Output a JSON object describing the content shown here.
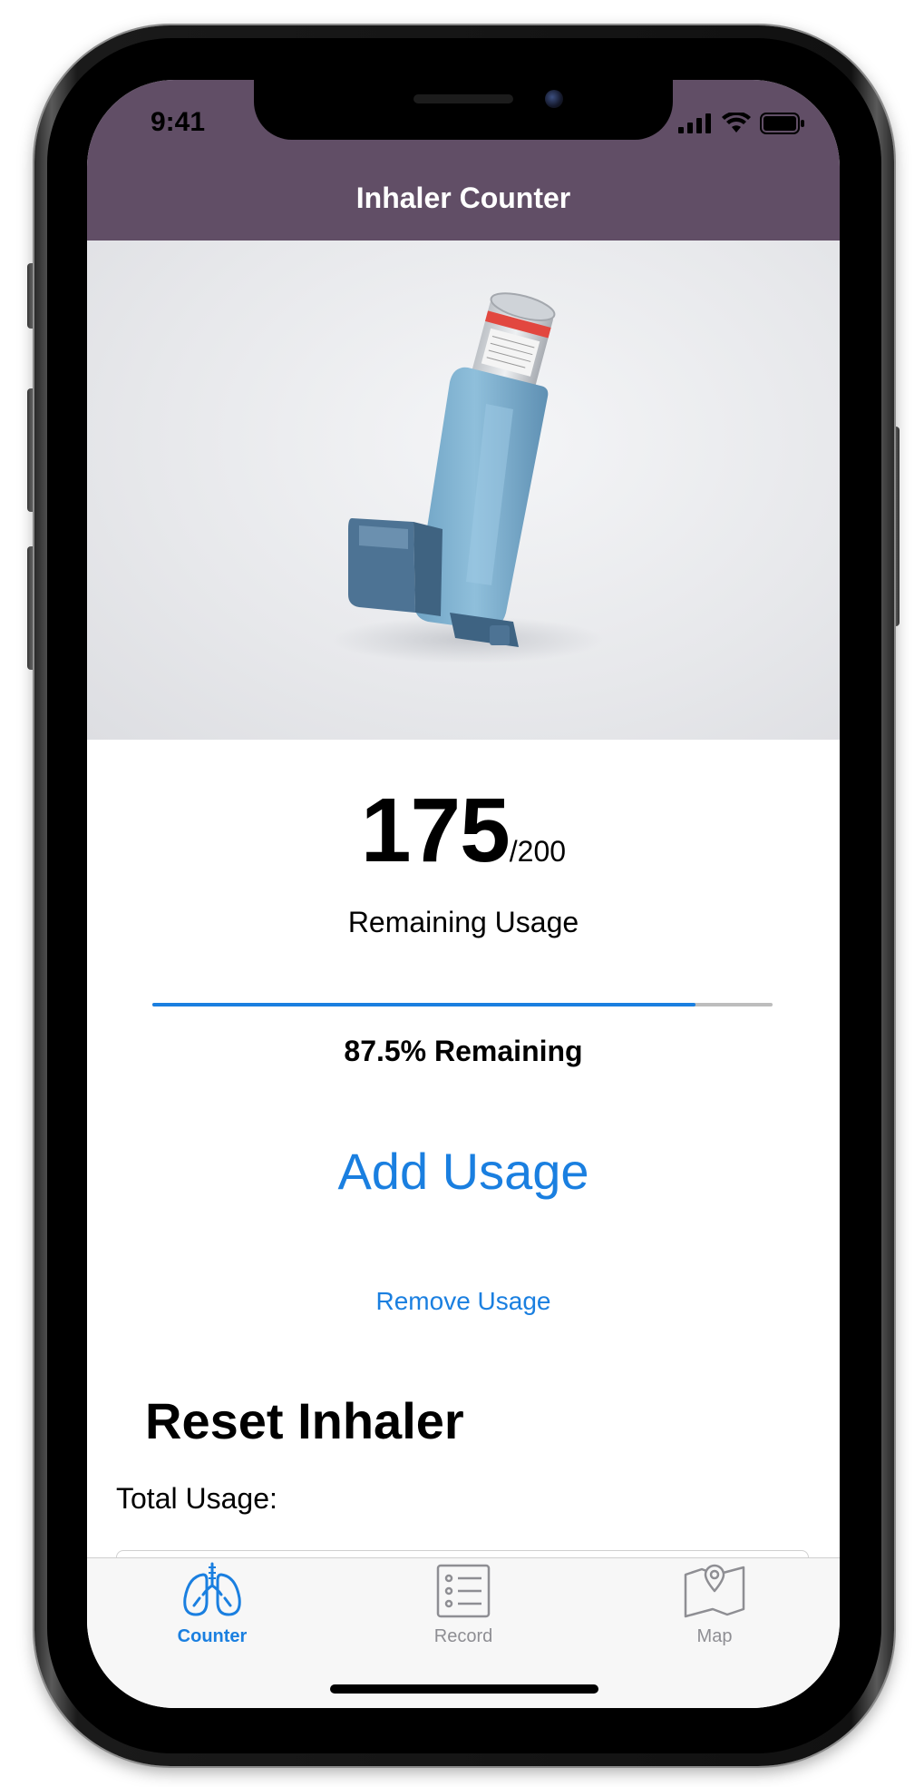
{
  "status_bar": {
    "time": "9:41"
  },
  "header": {
    "title": "Inhaler Counter"
  },
  "counter": {
    "remaining": "175",
    "total": "/200",
    "label": "Remaining Usage",
    "progress_fraction": 0.875,
    "percent_text": "87.5% Remaining"
  },
  "actions": {
    "add_label": "Add Usage",
    "remove_label": "Remove Usage"
  },
  "reset": {
    "title": "Reset Inhaler",
    "total_usage_label": "Total Usage:"
  },
  "tabbar": {
    "tabs": [
      {
        "label": "Counter",
        "icon": "lungs-icon"
      },
      {
        "label": "Record",
        "icon": "list-icon"
      },
      {
        "label": "Map",
        "icon": "map-icon"
      }
    ]
  },
  "colors": {
    "header_bg": "#614e66",
    "accent": "#1a7fe0",
    "inactive": "#8e8e93",
    "inhaler_body": "#7fb1cf",
    "inhaler_mouth": "#4d7394",
    "canister_band": "#e2473f"
  }
}
